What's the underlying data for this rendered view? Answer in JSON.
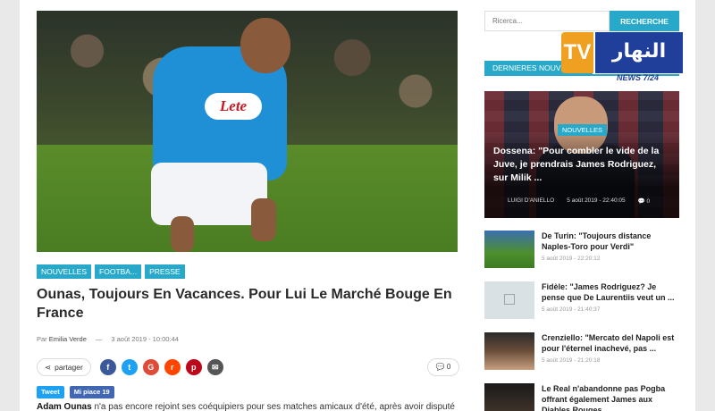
{
  "article": {
    "tags": [
      "NOUVELLES",
      "FOOTBA...",
      "PRESSE"
    ],
    "title": "Ounas, Toujours En Vacances. Pour Lui Le Marché Bouge En France",
    "author_prefix": "Par",
    "author": "Emilia Verde",
    "separator": "—",
    "date": "3 août 2019 - 10:00:44",
    "share_label": "partager",
    "comment_count": "0",
    "tweet_label": "Tweet",
    "like_label": "Mi piace 19",
    "body_lead": "Adam Ounas",
    "body_rest": " n'a pas encore rejoint ses coéquipiers pour ses matches amicaux d'été, après avoir disputé la",
    "jersey_sponsor": "Lete"
  },
  "social_icons": [
    {
      "name": "facebook-icon",
      "glyph": "f",
      "color": "#3b5998"
    },
    {
      "name": "twitter-icon",
      "glyph": "t",
      "color": "#1da1f2"
    },
    {
      "name": "google-plus-icon",
      "glyph": "G",
      "color": "#dd4b39"
    },
    {
      "name": "reddit-icon",
      "glyph": "r",
      "color": "#ff4500"
    },
    {
      "name": "pinterest-icon",
      "glyph": "p",
      "color": "#bd081c"
    },
    {
      "name": "email-icon",
      "glyph": "✉",
      "color": "#555555"
    }
  ],
  "search": {
    "placeholder": "Ricerca...",
    "button": "RECHERCHE"
  },
  "sidebar": {
    "section_title": "DERNIERES NOUVELLES",
    "featured": {
      "badge": "NOUVELLES",
      "title": "Dossena: \"Pour combler le vide de la Juve, je prendrais James Rodriguez, sur Milik ...",
      "author": "LUIGI D'ANIELLO",
      "date": "5 août 2019 - 22:40:05",
      "comments": "0"
    },
    "items": [
      {
        "title": "De Turin: \"Toujours distance Naples-Toro pour Verdi\"",
        "date": "5 août 2019 - 22:20:12"
      },
      {
        "title": "Fidèle: \"James Rodriguez? Je pense que De Laurentiis veut un ...",
        "date": "5 août 2019 - 21:40:37"
      },
      {
        "title": "Crenziello: \"Mercato del Napoli est pour l'éternel inachevé, pas ...",
        "date": "5 août 2019 - 21:20:18"
      },
      {
        "title": "Le Real n'abandonne pas Pogba offrant également James aux Diables Rouges",
        "date": ""
      }
    ]
  },
  "tv_logo": {
    "tv": "TV",
    "arabic": "النهار",
    "sub": "NEWS 7/24"
  }
}
